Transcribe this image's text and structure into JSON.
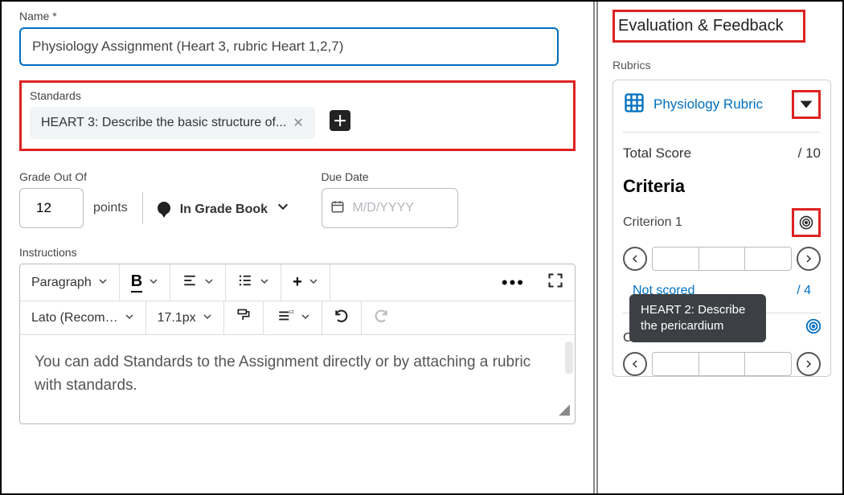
{
  "name_label": "Name *",
  "name_value": "Physiology Assignment (Heart 3, rubric Heart 1,2,7)",
  "standards": {
    "label": "Standards",
    "tag": "HEART 3: Describe the basic structure of..."
  },
  "grade_label": "Grade Out Of",
  "grade_value": "12",
  "points_text": "points",
  "gradebook_text": "In Grade Book",
  "due_label": "Due Date",
  "due_placeholder": "M/D/YYYY",
  "instructions_label": "Instructions",
  "editor": {
    "para": "Paragraph",
    "font": "Lato (Recom…",
    "size": "17.1px",
    "body": "You can add Standards to the Assignment directly or by attaching a rubric with standards."
  },
  "right": {
    "eval_title": "Evaluation & Feedback",
    "rubrics_label": "Rubrics",
    "rubric_name": "Physiology Rubric",
    "total_label": "Total Score",
    "total_max": "/ 10",
    "criteria_heading": "Criteria",
    "crit1": "Criterion 1",
    "not_scored": "Not scored",
    "crit1_max": "/ 4",
    "crit2_trunc": "C",
    "tooltip": "HEART 2: Describe the pericardium"
  }
}
